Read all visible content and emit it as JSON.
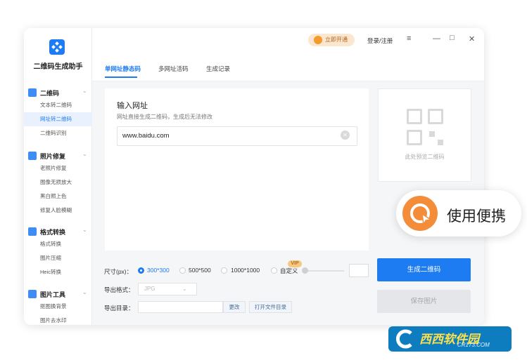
{
  "app": {
    "title": "二维码生成助手"
  },
  "sidebar": {
    "groups": [
      {
        "label": "二维码",
        "icon": "qrcode-icon",
        "items": [
          "文本转二维码",
          "网址转二维码",
          "二维码识别"
        ],
        "active": 1
      },
      {
        "label": "照片修复",
        "icon": "photo-icon",
        "items": [
          "老照片修复",
          "图像无损放大",
          "黑白照上色",
          "修复人脸模糊"
        ]
      },
      {
        "label": "格式转换",
        "icon": "convert-icon",
        "items": [
          "格式转换",
          "图片压缩",
          "Heic转换"
        ]
      },
      {
        "label": "图片工具",
        "icon": "image-tool-icon",
        "items": [
          "抠图换背景",
          "图片去水印"
        ]
      }
    ]
  },
  "topbar": {
    "vip_label": "立即开通",
    "login_label": "登录/注册"
  },
  "tabs": [
    "单网址静态码",
    "多网址活码",
    "生成记录"
  ],
  "panel": {
    "title": "输入网址",
    "subtitle": "网址直接生成二维码，生成后无法修改",
    "url_value": "www.baidu.com"
  },
  "preview": {
    "label": "此处预览二维码"
  },
  "size": {
    "label": "尺寸(px)：",
    "options": [
      "300*300",
      "500*500",
      "1000*1000",
      "自定义"
    ],
    "selected": "300*300",
    "vip_tag": "VIP"
  },
  "format": {
    "label": "导出格式：",
    "value": "JPG"
  },
  "directory": {
    "label": "导出目录：",
    "change_label": "更改",
    "open_label": "打开文件目录"
  },
  "actions": {
    "generate_label": "生成二维码",
    "save_label": "保存图片"
  },
  "promo": {
    "text": "使用便携"
  },
  "watermark": {
    "text": "西西软件园",
    "url": "CR173.COM"
  },
  "colors": {
    "accent": "#1e7cf2",
    "vip": "#fbe6cf",
    "promo_icon": "#f38d3a"
  }
}
